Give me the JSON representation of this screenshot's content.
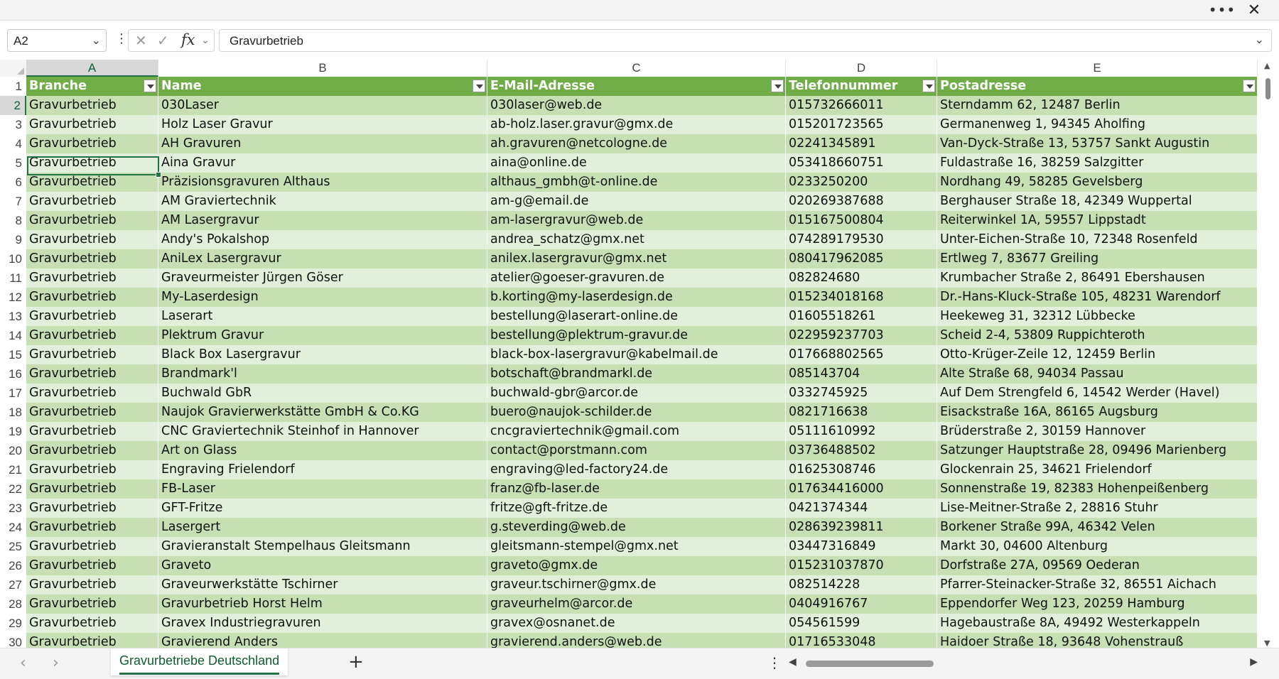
{
  "window": {
    "more_icon": "ellipsis-icon",
    "close_icon": "close-icon"
  },
  "formula_bar": {
    "name_box": "A2",
    "formula": "Gravurbetrieb"
  },
  "columns": [
    "A",
    "B",
    "C",
    "D",
    "E"
  ],
  "headers": [
    "Branche",
    "Name",
    "E-Mail-Adresse",
    "Telefonnummer",
    "Postadresse"
  ],
  "rows": [
    {
      "n": "2",
      "cells": [
        "Gravurbetrieb",
        "030Laser",
        "030laser@web.de",
        "015732666011",
        "Sterndamm 62, 12487 Berlin"
      ]
    },
    {
      "n": "3",
      "cells": [
        "Gravurbetrieb",
        "Holz Laser Gravur",
        "ab-holz.laser.gravur@gmx.de",
        "015201723565",
        "Germanenweg 1, 94345 Aholfing"
      ]
    },
    {
      "n": "4",
      "cells": [
        "Gravurbetrieb",
        "AH Gravuren",
        "ah.gravuren@netcologne.de",
        "02241345891",
        "Van-Dyck-Straße 13, 53757 Sankt Augustin"
      ]
    },
    {
      "n": "5",
      "cells": [
        "Gravurbetrieb",
        "Aina Gravur",
        "aina@online.de",
        "053418660751",
        "Fuldastraße 16, 38259 Salzgitter"
      ]
    },
    {
      "n": "6",
      "cells": [
        "Gravurbetrieb",
        "Präzisionsgravuren Althaus",
        "althaus_gmbh@t-online.de",
        "0233250200",
        "Nordhang 49, 58285 Gevelsberg"
      ]
    },
    {
      "n": "7",
      "cells": [
        "Gravurbetrieb",
        "AM Graviertechnik",
        "am-g@email.de",
        "020269387688",
        "Berghauser Straße 18, 42349 Wuppertal"
      ]
    },
    {
      "n": "8",
      "cells": [
        "Gravurbetrieb",
        "AM Lasergravur",
        "am-lasergravur@web.de",
        "015167500804",
        "Reiterwinkel 1A, 59557 Lippstadt"
      ]
    },
    {
      "n": "9",
      "cells": [
        "Gravurbetrieb",
        "Andy's Pokalshop",
        "andrea_schatz@gmx.net",
        "074289179530",
        "Unter-Eichen-Straße 10, 72348 Rosenfeld"
      ]
    },
    {
      "n": "10",
      "cells": [
        "Gravurbetrieb",
        "AniLex Lasergravur",
        "anilex.lasergravur@gmx.net",
        "080417962085",
        "Ertlweg 7, 83677 Greiling"
      ]
    },
    {
      "n": "11",
      "cells": [
        "Gravurbetrieb",
        "Graveurmeister Jürgen Göser",
        "atelier@goeser-gravuren.de",
        "082824680",
        "Krumbacher Straße 2, 86491 Ebershausen"
      ]
    },
    {
      "n": "12",
      "cells": [
        "Gravurbetrieb",
        "My-Laserdesign",
        "b.korting@my-laserdesign.de",
        "015234018168",
        "Dr.-Hans-Kluck-Straße 105, 48231 Warendorf"
      ]
    },
    {
      "n": "13",
      "cells": [
        "Gravurbetrieb",
        "Laserart",
        "bestellung@laserart-online.de",
        "01605518261",
        "Heekeweg 31, 32312 Lübbecke"
      ]
    },
    {
      "n": "14",
      "cells": [
        "Gravurbetrieb",
        "Plektrum Gravur",
        "bestellung@plektrum-gravur.de",
        "022959237703",
        "Scheid 2-4, 53809 Ruppichteroth"
      ]
    },
    {
      "n": "15",
      "cells": [
        "Gravurbetrieb",
        "Black Box Lasergravur",
        "black-box-lasergravur@kabelmail.de",
        "017668802565",
        "Otto-Krüger-Zeile 12, 12459 Berlin"
      ]
    },
    {
      "n": "16",
      "cells": [
        "Gravurbetrieb",
        "Brandmark'l",
        "botschaft@brandmarkl.de",
        "085143704",
        "Alte Straße 68, 94034 Passau"
      ]
    },
    {
      "n": "17",
      "cells": [
        "Gravurbetrieb",
        "Buchwald GbR",
        "buchwald-gbr@arcor.de",
        "0332745925",
        "Auf Dem Strengfeld 6, 14542 Werder (Havel)"
      ]
    },
    {
      "n": "18",
      "cells": [
        "Gravurbetrieb",
        "Naujok Gravierwerkstätte GmbH & Co.KG",
        "buero@naujok-schilder.de",
        "0821716638",
        "Eisackstraße 16A, 86165 Augsburg"
      ]
    },
    {
      "n": "19",
      "cells": [
        "Gravurbetrieb",
        "CNC Graviertechnik Steinhof in Hannover",
        "cncgraviertechnik@gmail.com",
        "05111610992",
        "Brüderstraße 2, 30159 Hannover"
      ]
    },
    {
      "n": "20",
      "cells": [
        "Gravurbetrieb",
        "Art on Glass",
        "contact@porstmann.com",
        "03736488502",
        "Satzunger Hauptstraße 28, 09496 Marienberg"
      ]
    },
    {
      "n": "21",
      "cells": [
        "Gravurbetrieb",
        "Engraving Frielendorf",
        "engraving@led-factory24.de",
        "01625308746",
        "Glockenrain 25, 34621 Frielendorf"
      ]
    },
    {
      "n": "22",
      "cells": [
        "Gravurbetrieb",
        "FB-Laser",
        "franz@fb-laser.de",
        "017634416000",
        "Sonnenstraße 19, 82383 Hohenpeißenberg"
      ]
    },
    {
      "n": "23",
      "cells": [
        "Gravurbetrieb",
        "GFT-Fritze",
        "fritze@gft-fritze.de",
        "0421374344",
        "Lise-Meitner-Straße 2, 28816 Stuhr"
      ]
    },
    {
      "n": "24",
      "cells": [
        "Gravurbetrieb",
        "Lasergert",
        "g.steverding@web.de",
        "028639239811",
        "Borkener Straße 99A, 46342 Velen"
      ]
    },
    {
      "n": "25",
      "cells": [
        "Gravurbetrieb",
        "Gravieranstalt Stempelhaus Gleitsmann",
        "gleitsmann-stempel@gmx.net",
        "03447316849",
        "Markt 30, 04600 Altenburg"
      ]
    },
    {
      "n": "26",
      "cells": [
        "Gravurbetrieb",
        "Graveto",
        "graveto@gmx.de",
        "015231037870",
        "Dorfstraße 27A, 09569 Oederan"
      ]
    },
    {
      "n": "27",
      "cells": [
        "Gravurbetrieb",
        "Graveurwerkstätte Tschirner",
        "graveur.tschirner@gmx.de",
        "082514228",
        "Pfarrer-Steinacker-Straße 32, 86551 Aichach"
      ]
    },
    {
      "n": "28",
      "cells": [
        "Gravurbetrieb",
        "Gravurbetrieb Horst Helm",
        "graveurhelm@arcor.de",
        "0404916767",
        "Eppendorfer Weg 123, 20259 Hamburg"
      ]
    },
    {
      "n": "29",
      "cells": [
        "Gravurbetrieb",
        "Gravex Industriegravuren",
        "gravex@osnanet.de",
        "054561599",
        "Hagebaustraße 8A, 49492 Westerkappeln"
      ]
    },
    {
      "n": "30",
      "cells": [
        "Gravurbetrieb",
        "Gravierend Anders",
        "gravierend.anders@web.de",
        "01716533048",
        "Haidoer Straße 18, 93648 Vohenstrauß"
      ]
    }
  ],
  "header_row_number": "1",
  "colors": {
    "header_green": "#70ad47",
    "band_dark": "#c6e0b4",
    "band_light": "#e2efda",
    "accent": "#217346"
  },
  "sheet_tab": "Gravurbetriebe Deutschland",
  "bottom": {
    "add_sheet_icon": "plus-icon",
    "prev_icon": "chevron-left-icon",
    "next_icon": "chevron-right-icon"
  }
}
